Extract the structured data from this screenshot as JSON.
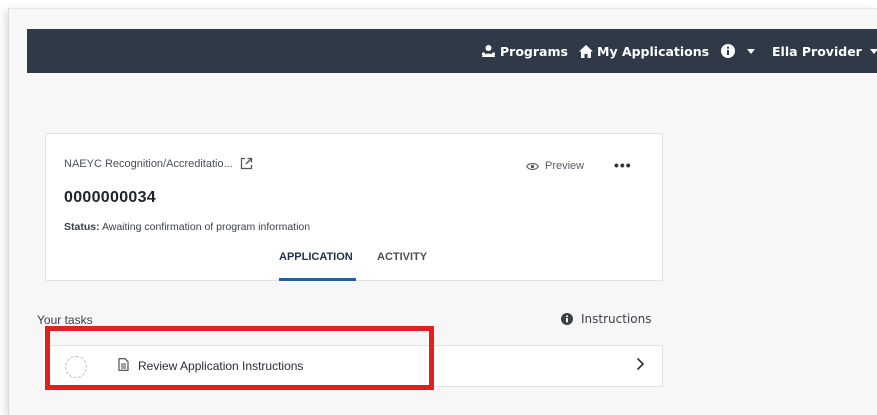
{
  "nav": {
    "programs_label": "Programs",
    "my_applications_label": "My Applications",
    "user_label": "Ella Provider"
  },
  "card": {
    "program_title": "NAEYC Recognition/Accreditatio...",
    "preview_label": "Preview",
    "more_label": "•••",
    "application_id": "0000000034",
    "status_label": "Status:",
    "status_value": "Awaiting confirmation of program information",
    "tabs": [
      {
        "label": "APPLICATION",
        "active": true
      },
      {
        "label": "ACTIVITY",
        "active": false
      }
    ]
  },
  "tasks": {
    "heading": "Your tasks",
    "instructions_label": "Instructions",
    "items": [
      {
        "label": "Review Application Instructions"
      }
    ]
  },
  "colors": {
    "topbar": "#2f3947",
    "accent_tab": "#2b5c9c",
    "highlight": "#e41f1f"
  }
}
